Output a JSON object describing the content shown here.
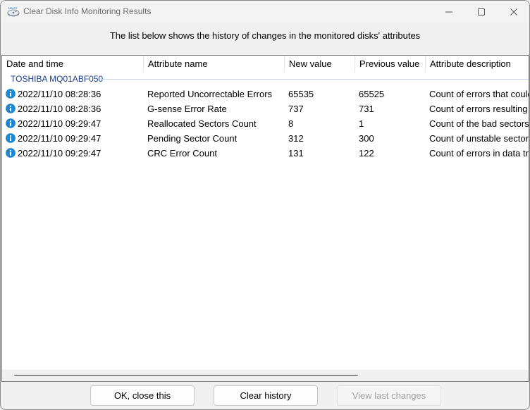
{
  "window": {
    "title": "Clear Disk Info Monitoring Results",
    "app_icon_badge": "SMART"
  },
  "message": "The list below shows the history of changes in the monitored disks' attributes",
  "columns": [
    "Date and time",
    "Attribute name",
    "New value",
    "Previous value",
    "Attribute description"
  ],
  "group": "TOSHIBA MQ01ABF050",
  "rows": [
    {
      "datetime": "2022/11/10 08:28:36",
      "attribute": "Reported Uncorrectable Errors",
      "new_value": "65535",
      "prev_value": "65525",
      "description": "Count of errors that could"
    },
    {
      "datetime": "2022/11/10 08:28:36",
      "attribute": "G-sense Error Rate",
      "new_value": "737",
      "prev_value": "731",
      "description": "Count of errors resulting"
    },
    {
      "datetime": "2022/11/10 09:29:47",
      "attribute": "Reallocated Sectors Count",
      "new_value": "8",
      "prev_value": "1",
      "description": "Count of the bad sectors"
    },
    {
      "datetime": "2022/11/10 09:29:47",
      "attribute": "Pending Sector Count",
      "new_value": "312",
      "prev_value": "300",
      "description": "Count of unstable sector"
    },
    {
      "datetime": "2022/11/10 09:29:47",
      "attribute": "CRC Error Count",
      "new_value": "131",
      "prev_value": "122",
      "description": "Count of errors in data tra"
    }
  ],
  "buttons": {
    "ok": "OK, close this",
    "clear": "Clear history",
    "view": "View last changes"
  },
  "icons": {
    "row": "info-icon",
    "minimize": "minimize-icon",
    "maximize": "maximize-icon",
    "close": "close-icon"
  },
  "colors": {
    "group_text": "#1e3d8a",
    "info_icon": "#1a8ad6"
  }
}
